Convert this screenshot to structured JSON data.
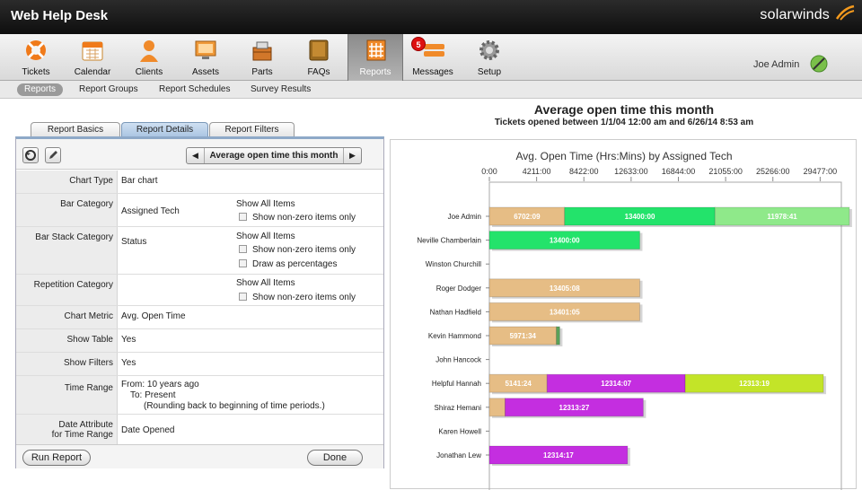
{
  "app": {
    "title": "Web Help Desk",
    "brand": "solarwinds"
  },
  "toolbar": {
    "items": [
      {
        "label": "Tickets",
        "icon": "lifebuoy-icon"
      },
      {
        "label": "Calendar",
        "icon": "calendar-icon"
      },
      {
        "label": "Clients",
        "icon": "person-icon"
      },
      {
        "label": "Assets",
        "icon": "monitor-icon"
      },
      {
        "label": "Parts",
        "icon": "parts-box-icon"
      },
      {
        "label": "FAQs",
        "icon": "book-icon"
      },
      {
        "label": "Reports",
        "icon": "report-icon"
      },
      {
        "label": "Messages",
        "icon": "messages-icon"
      },
      {
        "label": "Setup",
        "icon": "gear-icon"
      }
    ],
    "active": "Reports",
    "messages_badge": "5"
  },
  "user": {
    "name": "Joe Admin"
  },
  "subnav": {
    "items": [
      "Reports",
      "Report Groups",
      "Report Schedules",
      "Survey Results"
    ],
    "active": "Reports"
  },
  "tabs": {
    "items": [
      "Report Basics",
      "Report Details",
      "Report Filters"
    ],
    "active": "Report Details"
  },
  "report": {
    "name": "Average open time this month",
    "rows": {
      "chart_type": {
        "label": "Chart Type",
        "value": "Bar chart"
      },
      "bar_category": {
        "label": "Bar Category",
        "value": "Assigned Tech",
        "opt1": "Show All Items",
        "opt2": "Show non-zero items only"
      },
      "bar_stack": {
        "label": "Bar Stack Category",
        "value": "Status",
        "opt1": "Show All Items",
        "opt2": "Show non-zero items only",
        "opt3": "Draw as percentages"
      },
      "repetition": {
        "label": "Repetition Category",
        "opt1": "Show All Items",
        "opt2": "Show non-zero items only"
      },
      "chart_metric": {
        "label": "Chart Metric",
        "value": "Avg. Open Time"
      },
      "show_table": {
        "label": "Show Table",
        "value": "Yes"
      },
      "show_filters": {
        "label": "Show Filters",
        "value": "Yes"
      },
      "time_range": {
        "label": "Time Range",
        "from": "From: 10 years  ago",
        "to": "To: Present",
        "note": "(Rounding back to beginning of time periods.)"
      },
      "date_attr": {
        "label1": "Date Attribute",
        "label2": "for Time Range",
        "value": "Date Opened"
      }
    },
    "buttons": {
      "run": "Run Report",
      "done": "Done"
    }
  },
  "chart_header": {
    "title": "Average open time this month",
    "subtitle": "Tickets opened between 1/1/04 12:00 am and 6/26/14 8:53 am"
  },
  "chart_data": {
    "type": "bar",
    "orientation": "horizontal",
    "stacked": true,
    "title": "Avg. Open Time (Hrs:Mins) by Assigned Tech",
    "ticks": [
      "0:00",
      "4211:00",
      "8422:00",
      "12633:00",
      "16844:00",
      "21055:00",
      "25266:00",
      "29477:00"
    ],
    "xlim": [
      0,
      33688
    ],
    "colors": {
      "tan": "#e6bd85",
      "green": "#23e36b",
      "lightgreen": "#8fe98a",
      "purple": "#c42ee0",
      "lime": "#c3e428",
      "darkgreen": "#5aa35a"
    },
    "categories": [
      "Joe Admin",
      "Neville Chamberlain",
      "Winston Churchill",
      "Roger Dodger",
      "Nathan Hadfield",
      "Kevin Hammond",
      "John Hancock",
      "Helpful Hannah",
      "Shiraz Hemani",
      "Karen Howell",
      "Jonathan Lew"
    ],
    "bars": [
      [
        {
          "value": 6702.15,
          "label": "6702:09",
          "color": "tan"
        },
        {
          "value": 13400,
          "label": "13400:00",
          "color": "green"
        },
        {
          "value": 11978.68,
          "label": "11978:41",
          "color": "lightgreen"
        }
      ],
      [
        {
          "value": 13400,
          "label": "13400:00",
          "color": "green"
        }
      ],
      [],
      [
        {
          "value": 13405.13,
          "label": "13405:08",
          "color": "tan"
        }
      ],
      [
        {
          "value": 13401.08,
          "label": "13401:05",
          "color": "tan"
        }
      ],
      [
        {
          "value": 5971.57,
          "label": "5971:34",
          "color": "tan"
        },
        {
          "value": 300,
          "label": "",
          "color": "darkgreen"
        }
      ],
      [],
      [
        {
          "value": 5141.4,
          "label": "5141:24",
          "color": "tan"
        },
        {
          "value": 12314.12,
          "label": "12314:07",
          "color": "purple"
        },
        {
          "value": 12313.32,
          "label": "12313:19",
          "color": "lime"
        }
      ],
      [
        {
          "value": 1400,
          "label": "",
          "color": "tan"
        },
        {
          "value": 12313.45,
          "label": "12313:27",
          "color": "purple"
        }
      ],
      [],
      [
        {
          "value": 12314.28,
          "label": "12314:17",
          "color": "purple"
        }
      ]
    ]
  }
}
